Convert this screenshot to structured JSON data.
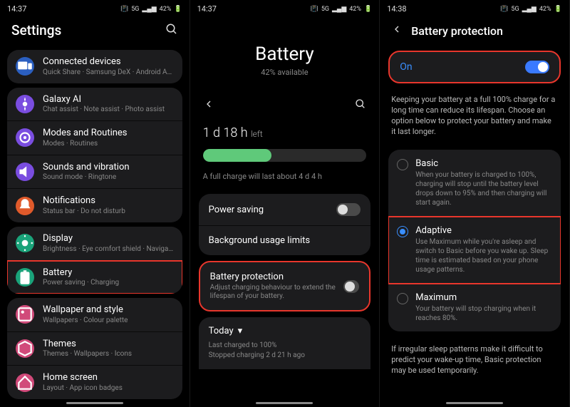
{
  "status": {
    "time1": "14:37",
    "time2": "14:37",
    "time3": "14:38",
    "right": "42%"
  },
  "panel1": {
    "title": "Settings",
    "groups": [
      [
        {
          "title": "Connected devices",
          "sub": "Quick Share · Samsung DeX · Android Auto",
          "color": "#2b5fc0",
          "icon": "devices"
        }
      ],
      [
        {
          "title": "Galaxy AI",
          "sub": "Chat assist · Note assist · Photo assist",
          "color": "#7a4de0",
          "icon": "ai"
        },
        {
          "title": "Modes and Routines",
          "sub": "Modes · Routines",
          "color": "#7a4de0",
          "icon": "modes"
        },
        {
          "title": "Sounds and vibration",
          "sub": "Sound mode · Ringtone",
          "color": "#7a4de0",
          "icon": "sound"
        },
        {
          "title": "Notifications",
          "sub": "Status bar · Do not disturb",
          "color": "#e05a2b",
          "icon": "notif"
        }
      ],
      [
        {
          "title": "Display",
          "sub": "Brightness · Eye comfort shield · Navigation bar",
          "color": "#1aa37a",
          "icon": "display"
        },
        {
          "title": "Battery",
          "sub": "Power saving · Charging",
          "color": "#1aa37a",
          "icon": "battery",
          "highlight": true
        }
      ],
      [
        {
          "title": "Wallpaper and style",
          "sub": "Wallpapers · Colour palette",
          "color": "#d14a7a",
          "icon": "wallpaper"
        },
        {
          "title": "Themes",
          "sub": "Themes · Wallpapers · Icons",
          "color": "#d14a7a",
          "icon": "themes"
        },
        {
          "title": "Home screen",
          "sub": "Layout · App icon badges",
          "color": "#d14a7a",
          "icon": "home"
        }
      ]
    ]
  },
  "panel2": {
    "hero": "Battery",
    "hero_sub": "42% available",
    "time_main": "1 d 18 h",
    "time_suffix": "left",
    "progress_pct": 42,
    "note": "A full charge will last about 4 d 4 h",
    "items": [
      {
        "title": "Power saving",
        "toggle": false
      },
      {
        "title": "Background usage limits"
      }
    ],
    "protection": {
      "title": "Battery protection",
      "sub": "Adjust charging behaviour to extend the lifespan of your battery.",
      "toggle": false,
      "highlight": true
    },
    "today": {
      "label": "Today",
      "line1": "Last charged to 100%",
      "line2": "Stopped charging 2 d 21 h ago"
    }
  },
  "panel3": {
    "title": "Battery protection",
    "on_label": "On",
    "on_state": true,
    "on_highlight": true,
    "desc": "Keeping your battery at a full 100% charge for a long time can reduce its lifespan. Choose an option below to protect your battery and make it last longer.",
    "options": [
      {
        "title": "Basic",
        "sub": "When your battery is charged to 100%, charging will stop until the battery level drops down to 95% and then charging will start again.",
        "selected": false
      },
      {
        "title": "Adaptive",
        "sub": "Use Maximum while you're asleep and switch to Basic before you wake up. Sleep time is estimated based on your phone usage patterns.",
        "selected": true,
        "highlight": true
      },
      {
        "title": "Maximum",
        "sub": "Your battery will stop charging when it reaches 80%.",
        "selected": false
      }
    ],
    "footer": "If irregular sleep patterns make it difficult to predict your wake-up time, Basic protection may be used temporarily."
  }
}
